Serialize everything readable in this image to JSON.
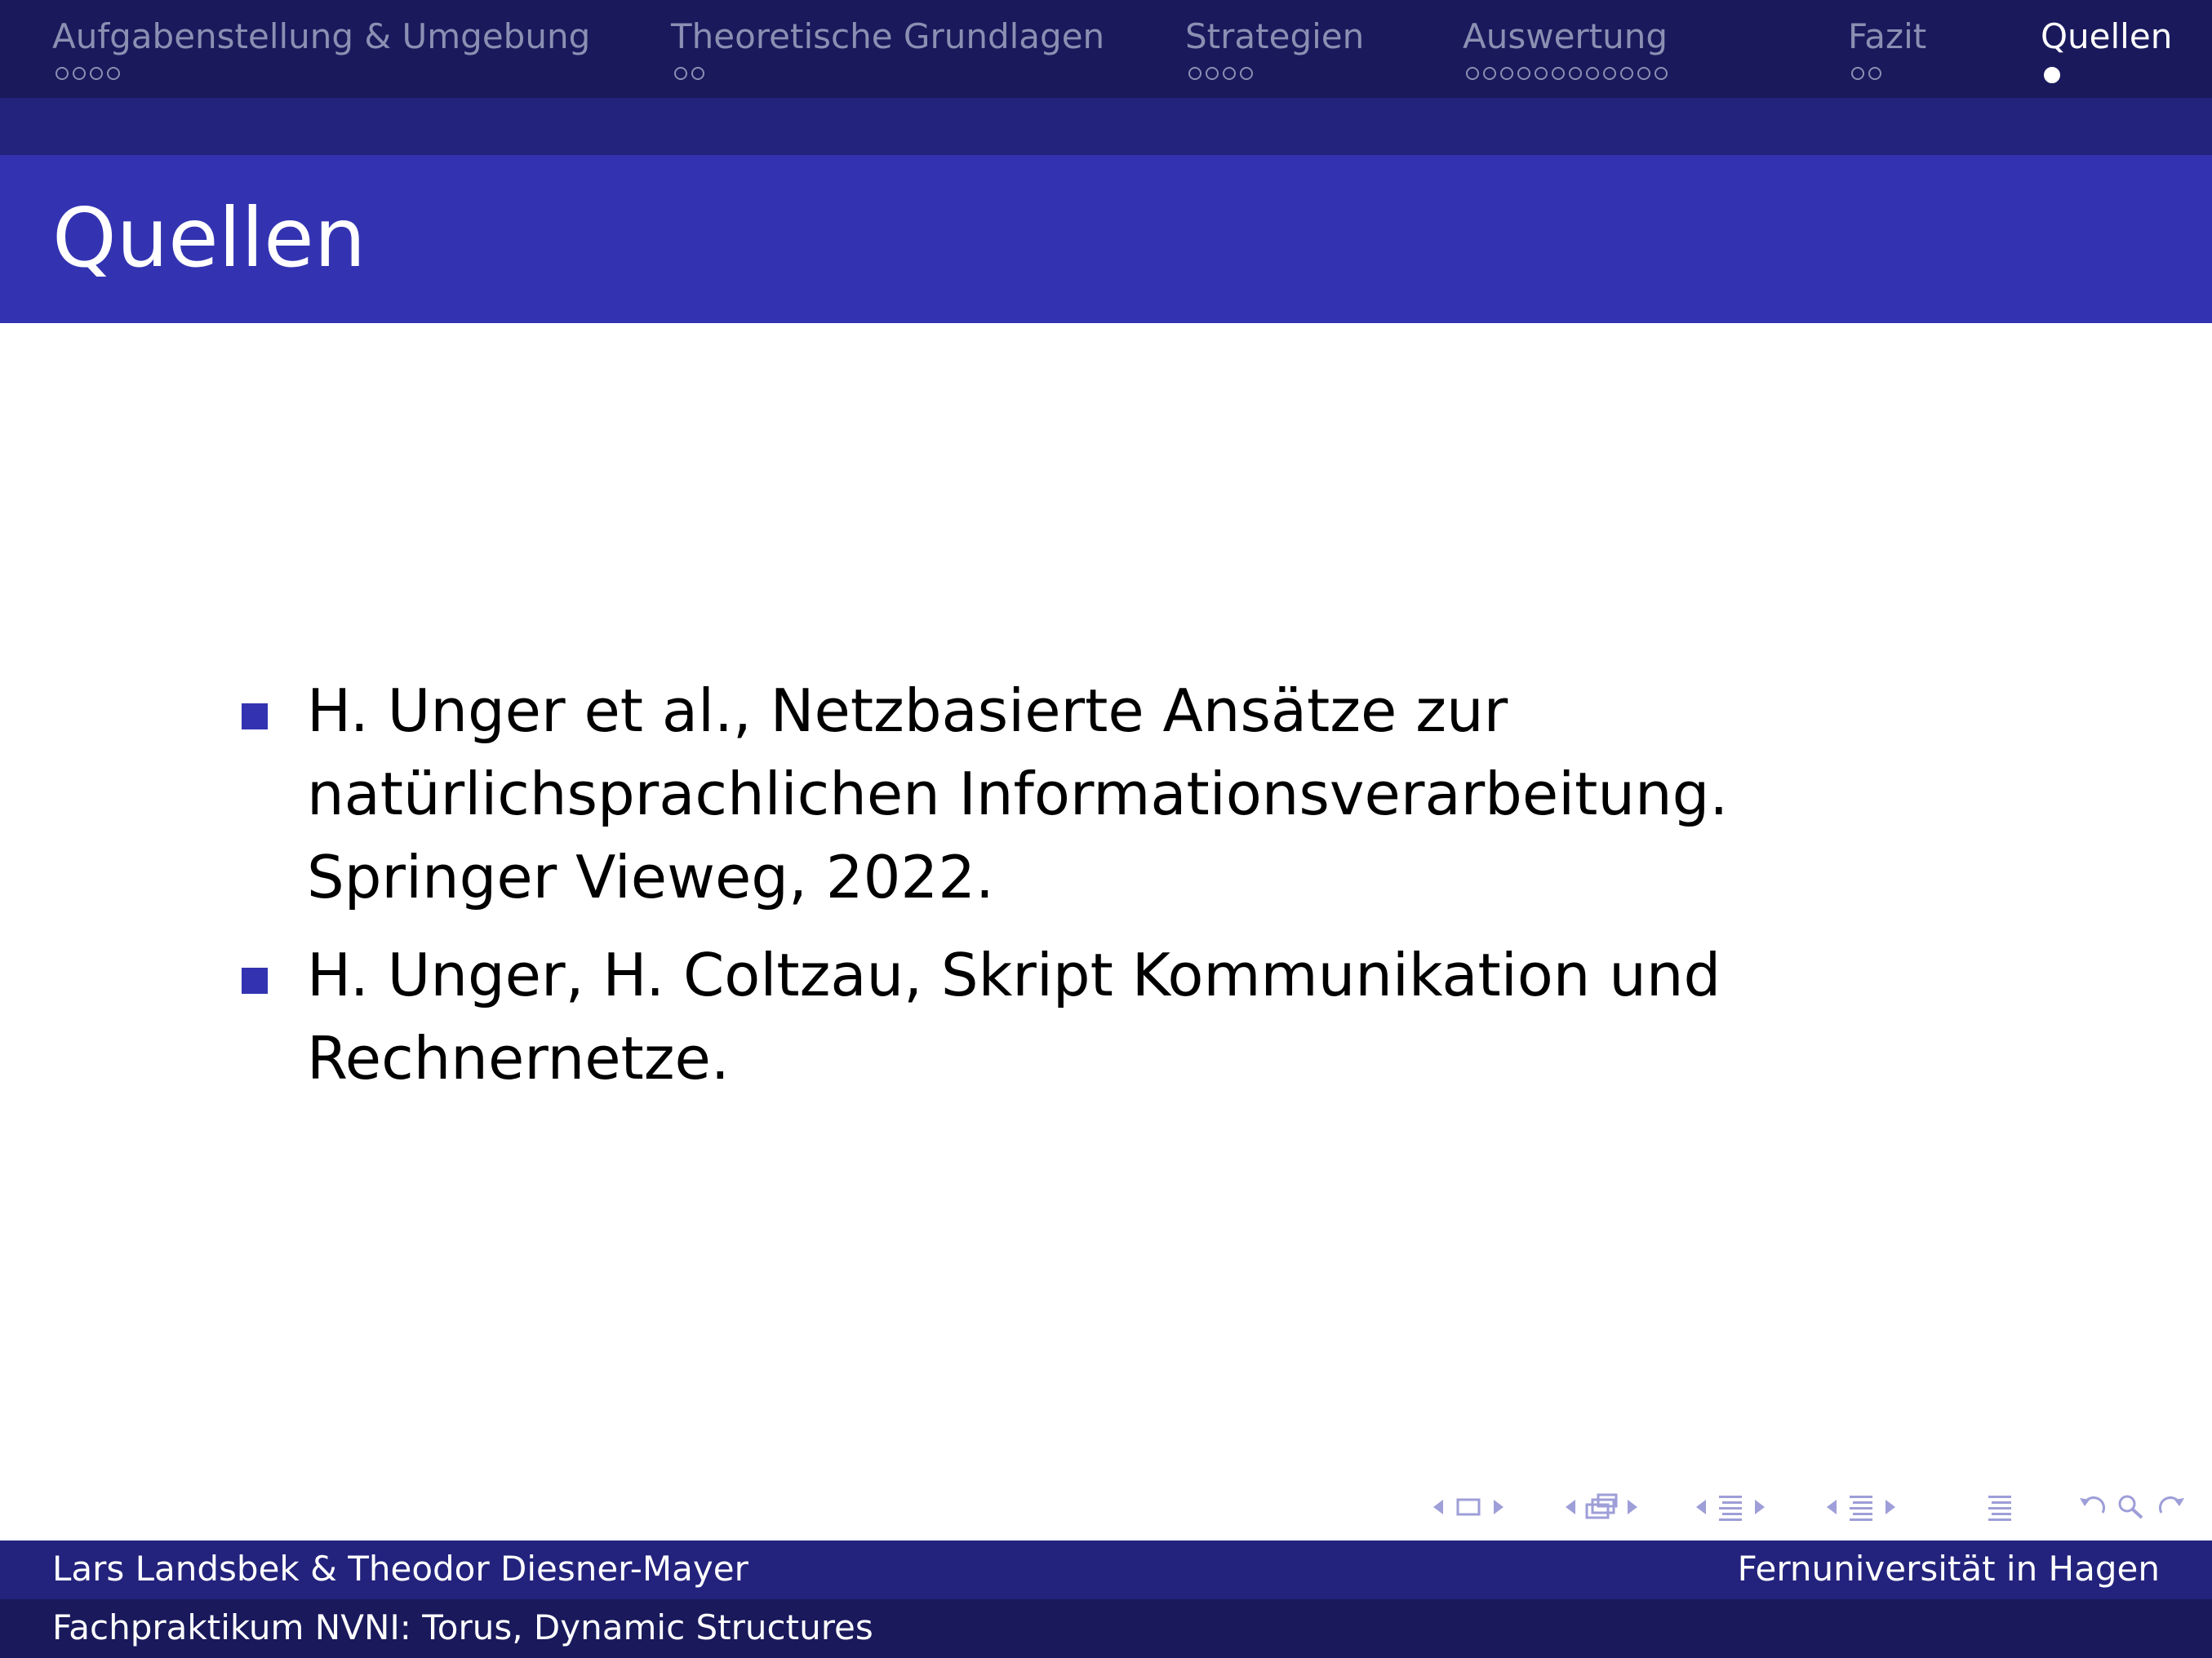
{
  "nav": {
    "sections": [
      {
        "label": "Aufgabenstellung & Umgebung",
        "slides": 4,
        "current": -1
      },
      {
        "label": "Theoretische Grundlagen",
        "slides": 2,
        "current": -1
      },
      {
        "label": "Strategien",
        "slides": 4,
        "current": -1
      },
      {
        "label": "Auswertung",
        "slides": 12,
        "current": -1
      },
      {
        "label": "Fazit",
        "slides": 2,
        "current": -1
      },
      {
        "label": "Quellen",
        "slides": 1,
        "current": 0
      }
    ],
    "active_section": "Quellen"
  },
  "frame": {
    "title": "Quellen"
  },
  "references": [
    "H. Unger et al., Netzbasierte Ansätze zur natürlichsprachlichen Informationsverarbeitung. Springer Vieweg, 2022.",
    "H. Unger, H. Coltzau, Skript Kommunikation und Rechnernetze."
  ],
  "footer": {
    "authors": "Lars Landsbek & Theodor Diesner-Mayer",
    "institute": "Fernuniversität in Hagen",
    "course": "Fachpraktikum NVNI: Torus, Dynamic Structures"
  },
  "colors": {
    "structure": "#3333b2",
    "nav_bg": "#19195c",
    "subbar_bg": "#23237d",
    "inactive_text": "#8b8fb2",
    "nav_symbols": "#9e9ed8"
  }
}
